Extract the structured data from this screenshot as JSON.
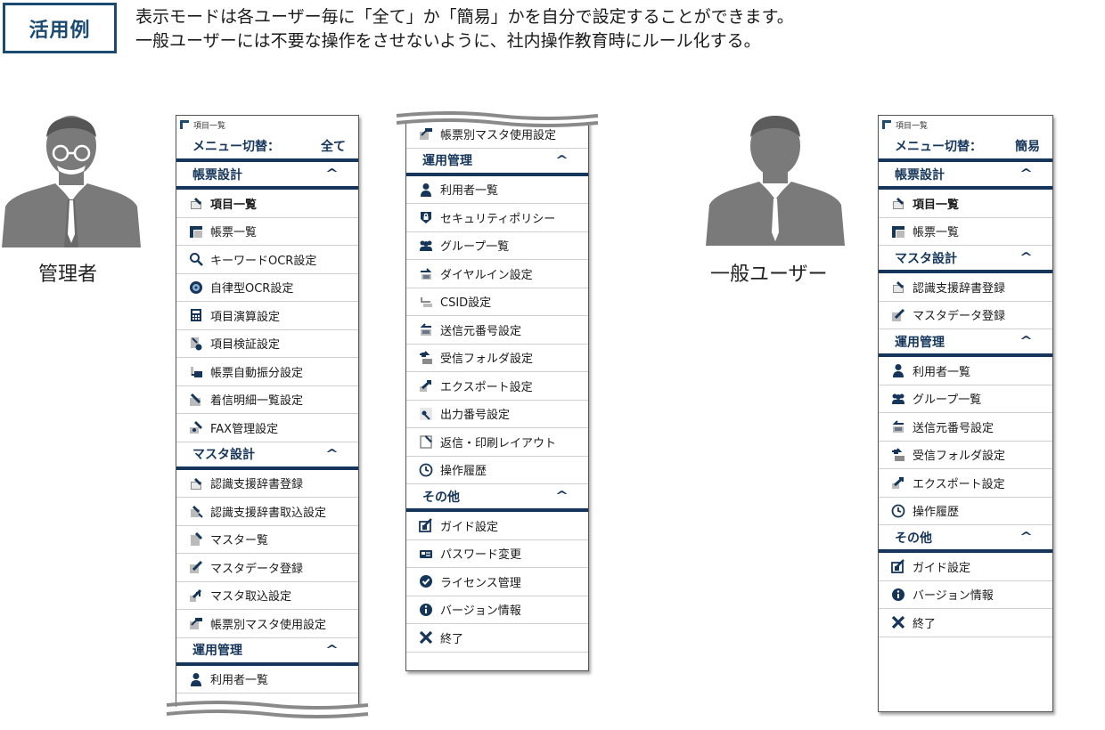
{
  "header": {
    "badge": "活用例",
    "line1": "表示モードは各ユーザー毎に「全て」か「簡易」かを自分で設定することができます。",
    "line2": "一般ユーザーには不要な操作をさせないように、社内操作教育時にルール化する。"
  },
  "admin": {
    "label": "管理者"
  },
  "general": {
    "label": "一般ユーザー"
  },
  "panel1": {
    "title": "項目一覧",
    "switch_label": "メニュー切替：",
    "switch_value": "全て",
    "sec1": "帳票設計",
    "items1": [
      {
        "label": "項目一覧",
        "icon": "form-icon"
      },
      {
        "label": "帳票一覧",
        "icon": "table-icon"
      },
      {
        "label": "キーワードOCR設定",
        "icon": "magnifier-icon"
      },
      {
        "label": "自律型OCR設定",
        "icon": "globe-icon"
      },
      {
        "label": "項目演算設定",
        "icon": "calculator-icon"
      },
      {
        "label": "項目検証設定",
        "icon": "verify-icon"
      },
      {
        "label": "帳票自動振分設定",
        "icon": "sort-icon"
      },
      {
        "label": "着信明細一覧設定",
        "icon": "list-detail-icon"
      },
      {
        "label": "FAX管理設定",
        "icon": "fax-icon"
      }
    ],
    "sec2": "マスタ設計",
    "items2": [
      {
        "label": "認識支援辞書登録",
        "icon": "dictionary-icon"
      },
      {
        "label": "認識支援辞書取込設定",
        "icon": "dictionary-import-icon"
      },
      {
        "label": "マスター覧",
        "icon": "master-list-icon"
      },
      {
        "label": "マスタデータ登録",
        "icon": "edit-icon"
      },
      {
        "label": "マスタ取込設定",
        "icon": "import-icon"
      },
      {
        "label": "帳票別マスタ使用設定",
        "icon": "form-master-icon"
      }
    ],
    "sec3": "運用管理",
    "cut_item": "利用者一覧"
  },
  "panel2": {
    "cut_item": "帳票別マスタ使用設定",
    "sec1": "運用管理",
    "items1": [
      {
        "label": "利用者一覧",
        "icon": "user-icon"
      },
      {
        "label": "セキュリティポリシー",
        "icon": "lock-icon"
      },
      {
        "label": "グループ一覧",
        "icon": "group-icon"
      },
      {
        "label": "ダイヤルイン設定",
        "icon": "dial-icon"
      },
      {
        "label": "CSID設定",
        "icon": "csid-icon"
      },
      {
        "label": "送信元番号設定",
        "icon": "sender-icon"
      },
      {
        "label": "受信フォルダ設定",
        "icon": "inbox-icon"
      },
      {
        "label": "エクスポート設定",
        "icon": "export-icon"
      },
      {
        "label": "出力番号設定",
        "icon": "output-number-icon"
      },
      {
        "label": "返信・印刷レイアウト",
        "icon": "layout-icon"
      },
      {
        "label": "操作履歴",
        "icon": "history-icon"
      }
    ],
    "sec2": "その他",
    "items2": [
      {
        "label": "ガイド設定",
        "icon": "guide-icon"
      },
      {
        "label": "パスワード変更",
        "icon": "password-icon"
      },
      {
        "label": "ライセンス管理",
        "icon": "check-icon"
      },
      {
        "label": "バージョン情報",
        "icon": "info-icon"
      },
      {
        "label": "終了",
        "icon": "close-icon"
      }
    ]
  },
  "panel3": {
    "title": "項目一覧",
    "switch_label": "メニュー切替：",
    "switch_value": "簡易",
    "sec1": "帳票設計",
    "items1": [
      {
        "label": "項目一覧",
        "icon": "form-icon"
      },
      {
        "label": "帳票一覧",
        "icon": "table-icon"
      }
    ],
    "sec2": "マスタ設計",
    "items2": [
      {
        "label": "認識支援辞書登録",
        "icon": "dictionary-icon"
      },
      {
        "label": "マスタデータ登録",
        "icon": "edit-icon"
      }
    ],
    "sec3": "運用管理",
    "items3": [
      {
        "label": "利用者一覧",
        "icon": "user-icon"
      },
      {
        "label": "グループ一覧",
        "icon": "group-icon"
      },
      {
        "label": "送信元番号設定",
        "icon": "sender-icon"
      },
      {
        "label": "受信フォルダ設定",
        "icon": "inbox-icon"
      },
      {
        "label": "エクスポート設定",
        "icon": "export-icon"
      },
      {
        "label": "操作履歴",
        "icon": "history-icon"
      }
    ],
    "sec4": "その他",
    "items4": [
      {
        "label": "ガイド設定",
        "icon": "guide-icon"
      },
      {
        "label": "バージョン情報",
        "icon": "info-icon"
      },
      {
        "label": "終了",
        "icon": "close-icon"
      }
    ]
  }
}
